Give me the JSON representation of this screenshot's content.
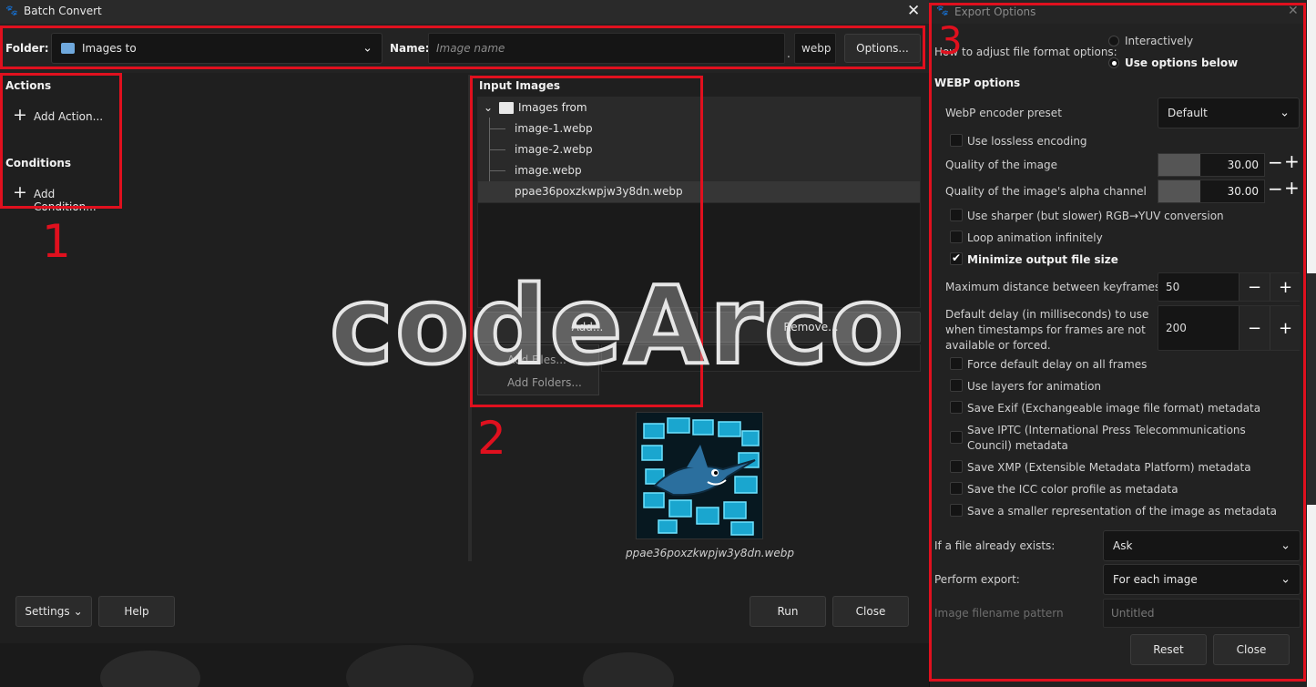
{
  "batch": {
    "title": "Batch Convert",
    "folder_label": "Folder:",
    "folder_value": "Images to",
    "name_label": "Name:",
    "name_placeholder": "Image name",
    "dot": ".",
    "extension": "webp",
    "options_button": "Options...",
    "actions_header": "Actions",
    "add_action": "Add Action...",
    "conditions_header": "Conditions",
    "add_condition": "Add Condition...",
    "input_images_header": "Input Images",
    "tree_root": "Images from",
    "tree_items": [
      "image-1.webp",
      "image-2.webp",
      "image.webp",
      "ppae36poxzkwpjw3y8dn.webp"
    ],
    "add_button": "Add...",
    "remove_button": "Remove...",
    "add_files": "Add Files...",
    "add_folders": "Add Folders...",
    "preview_caption": "ppae36poxzkwpjw3y8dn.webp",
    "settings_button": "Settings",
    "help_button": "Help",
    "run_button": "Run",
    "close_button": "Close"
  },
  "export": {
    "title": "Export Options",
    "how_label": "How to adjust file format options:",
    "radio_interactive": "Interactively",
    "radio_options": "Use options below",
    "section": "WEBP options",
    "preset_label": "WebP encoder preset",
    "preset_value": "Default",
    "lossless": "Use lossless encoding",
    "quality_label": "Quality of the image",
    "quality_value": "30.00",
    "alpha_label": "Quality of the image's alpha channel",
    "alpha_value": "30.00",
    "sharper": "Use sharper (but slower) RGB→YUV conversion",
    "loop": "Loop animation infinitely",
    "minimize": "Minimize output file size",
    "keyframes_label": "Maximum distance between keyframes",
    "keyframes_value": "50",
    "delay_label": "Default delay (in milliseconds) to use when timestamps for frames are not available or forced.",
    "delay_value": "200",
    "force_delay": "Force default delay on all frames",
    "use_layers": "Use layers for animation",
    "exif": "Save Exif (Exchangeable image file format) metadata",
    "iptc": "Save IPTC (International Press Telecommunications Council) metadata",
    "xmp": "Save XMP (Extensible Metadata Platform) metadata",
    "icc": "Save the ICC color profile as metadata",
    "thumb": "Save a smaller representation of the image as metadata",
    "exists_label": "If a file already exists:",
    "exists_value": "Ask",
    "perform_label": "Perform export:",
    "perform_value": "For each image",
    "pattern_label": "Image filename pattern",
    "pattern_placeholder": "Untitled",
    "reset_button": "Reset",
    "close_button": "Close"
  },
  "overlay": {
    "watermark": "codeArco",
    "marker_1": "1",
    "marker_2": "2",
    "marker_3": "3"
  },
  "colors": {
    "annotation_red": "#e0101e",
    "background": "#1f1f1f",
    "panel": "#222222"
  }
}
